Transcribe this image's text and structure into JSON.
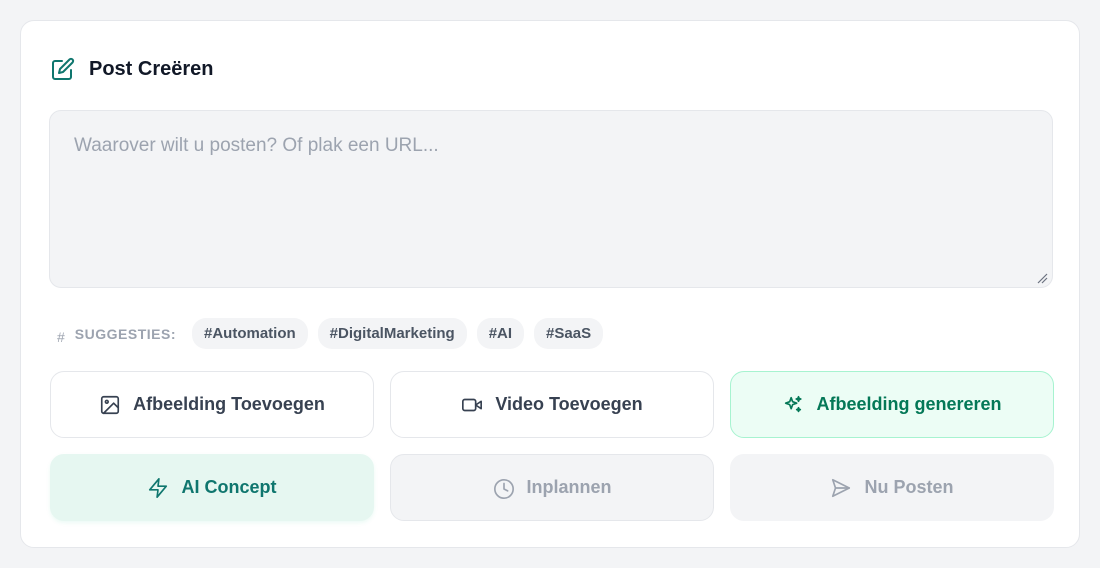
{
  "header": {
    "title": "Post Creëren",
    "icon": "edit-icon"
  },
  "composer": {
    "placeholder": "Waarover wilt u posten? Of plak een URL...",
    "value": ""
  },
  "suggestions": {
    "label": "SUGGESTIES:",
    "hash_symbol": "#",
    "tags": [
      "#Automation",
      "#DigitalMarketing",
      "#AI",
      "#SaaS"
    ]
  },
  "actions": {
    "add_image": {
      "label": "Afbeelding Toevoegen",
      "icon": "image-icon"
    },
    "add_video": {
      "label": "Video Toevoegen",
      "icon": "video-icon"
    },
    "generate_image": {
      "label": "Afbeelding genereren",
      "icon": "sparkles-icon"
    },
    "ai_concept": {
      "label": "AI Concept",
      "icon": "lightning-icon"
    },
    "schedule": {
      "label": "Inplannen",
      "icon": "clock-icon"
    },
    "post_now": {
      "label": "Nu Posten",
      "icon": "send-icon"
    }
  },
  "colors": {
    "accent": "#047857",
    "accent_bg": "#ecfdf5",
    "disabled": "#9ca3af"
  }
}
